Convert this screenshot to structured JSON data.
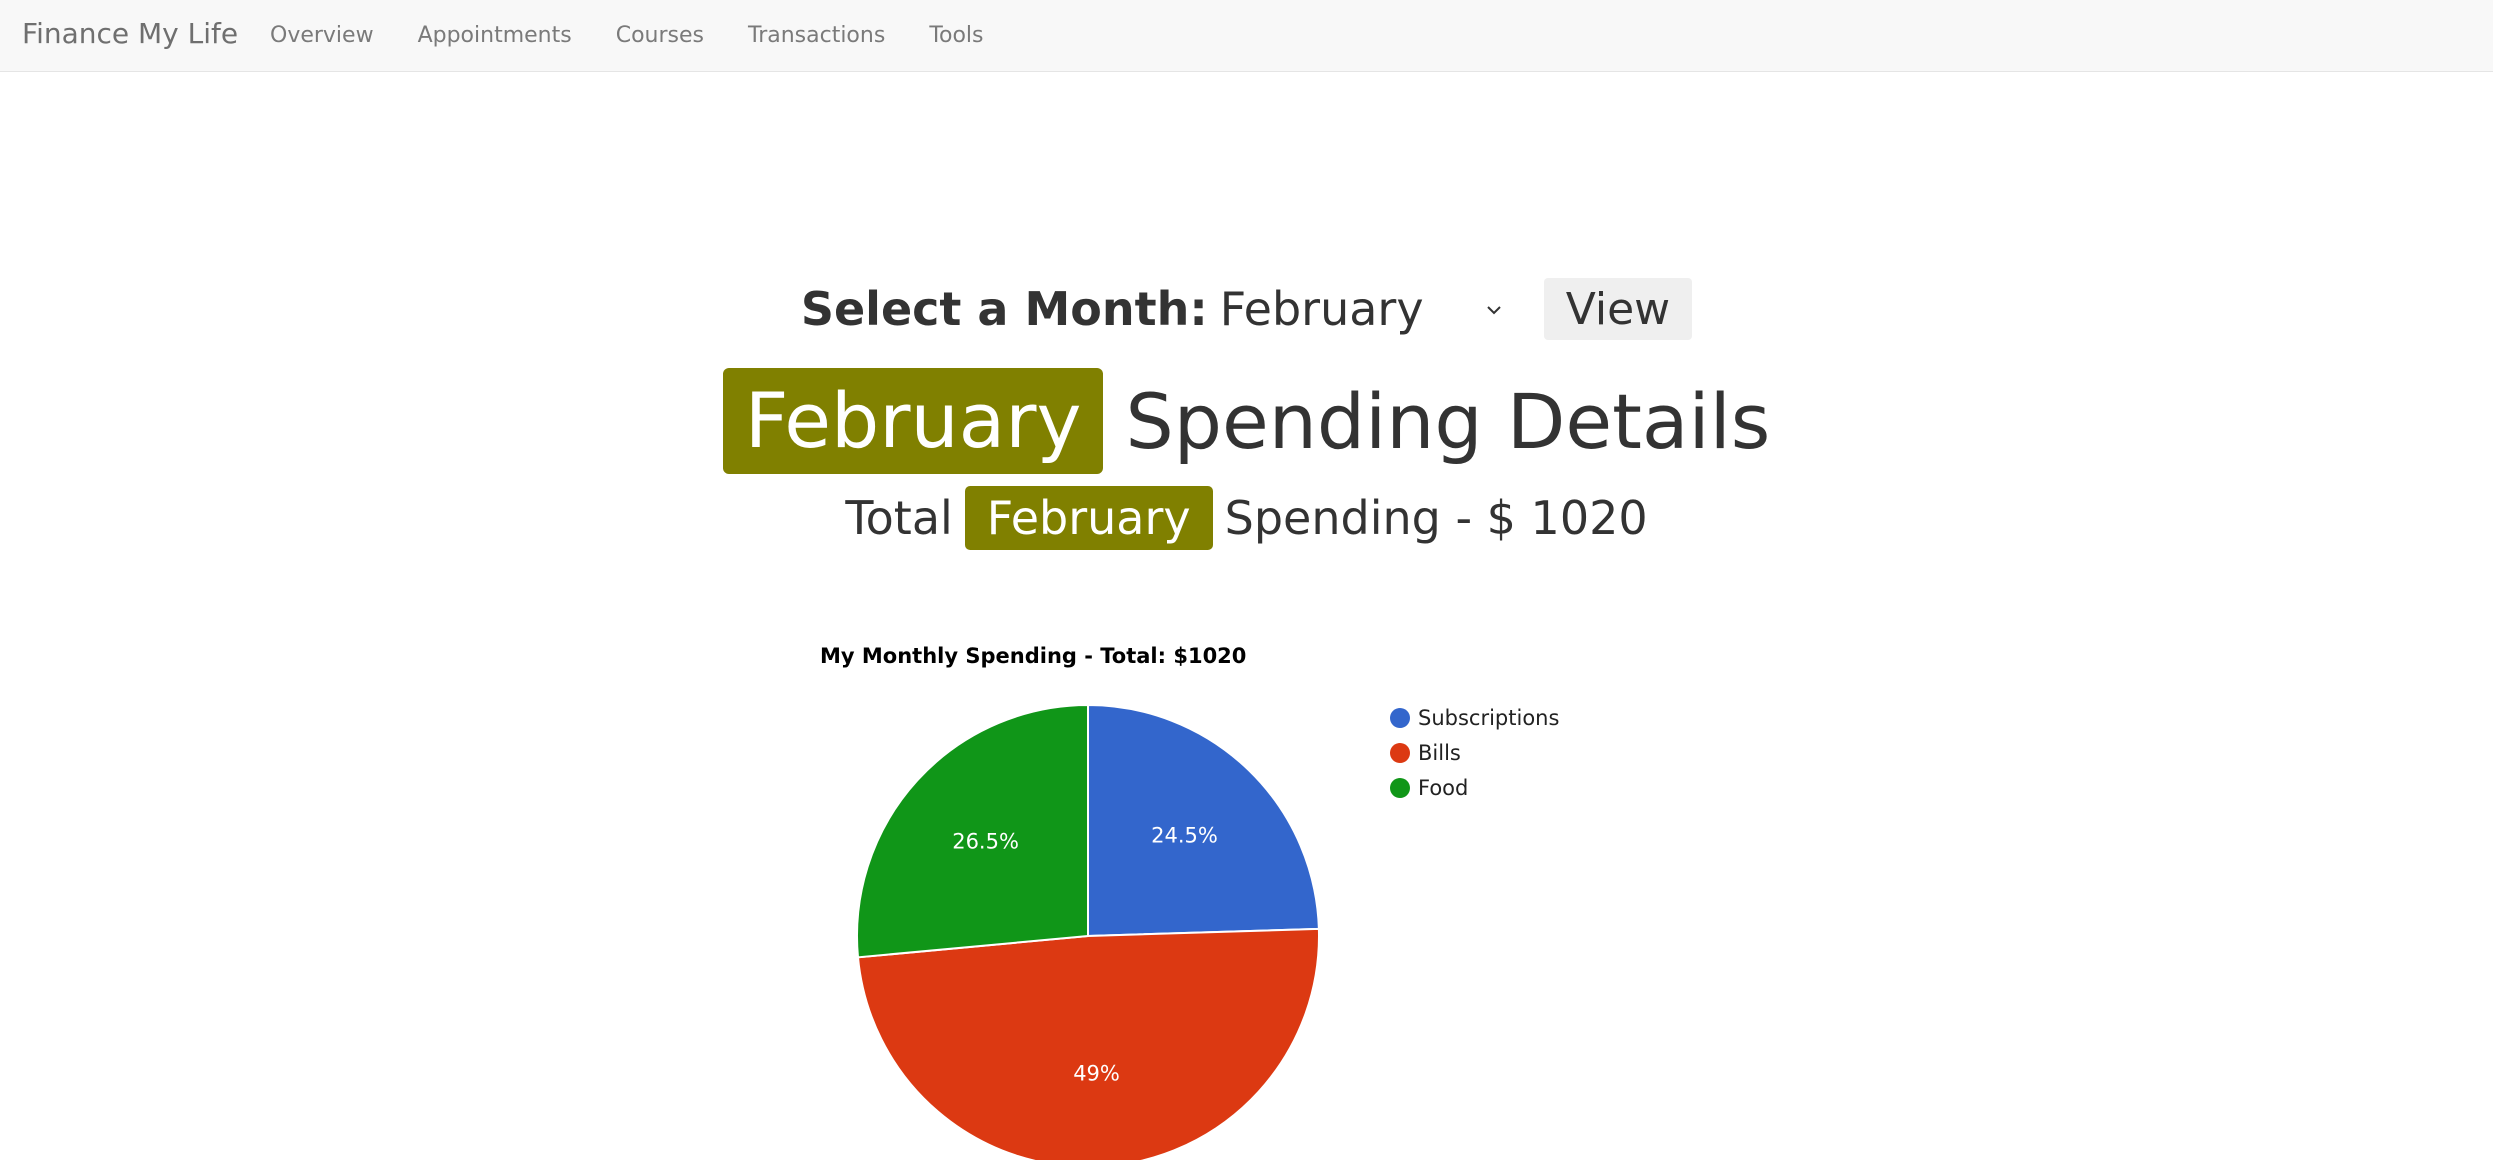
{
  "navbar": {
    "brand": "Finance My Life",
    "links": [
      "Overview",
      "Appointments",
      "Courses",
      "Transactions",
      "Tools"
    ]
  },
  "month_select": {
    "label": "Select a Month:",
    "selected": "February",
    "button": "View"
  },
  "heading": {
    "month": "February",
    "rest": "Spending Details"
  },
  "total": {
    "prefix": "Total",
    "month": "February",
    "suffix": "Spending - $ 1020"
  },
  "chart_data": {
    "type": "pie",
    "title": "My Monthly Spending - Total: $1020",
    "categories": [
      "Subscriptions",
      "Bills",
      "Food"
    ],
    "values": [
      250,
      500,
      270
    ],
    "percent_labels": [
      "24.5%",
      "49%",
      "26.5%"
    ],
    "colors": [
      "#3366cc",
      "#dc3912",
      "#109618"
    ],
    "legend": "right"
  }
}
